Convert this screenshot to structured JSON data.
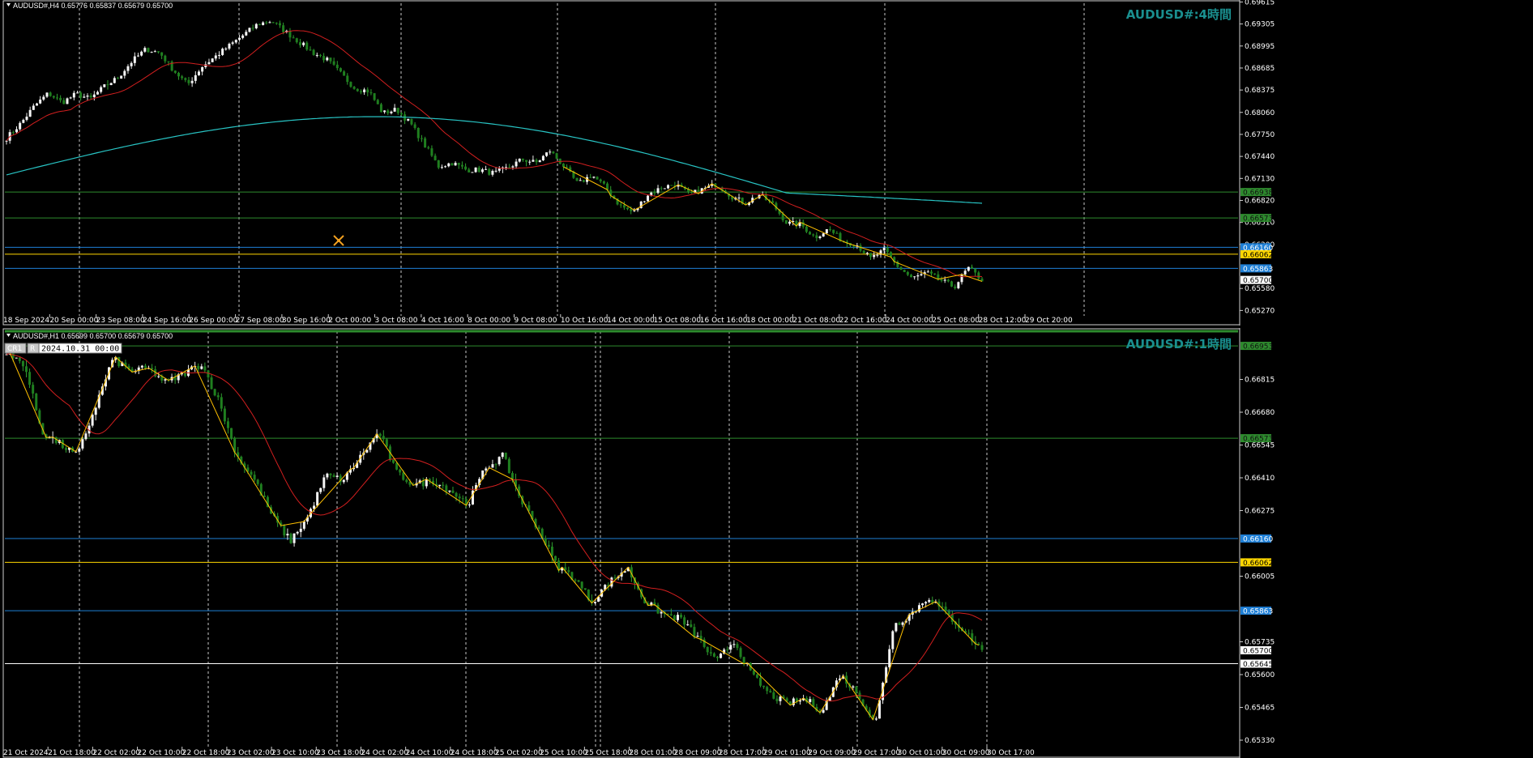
{
  "panels": [
    {
      "title": "AUDUSD#,H4  0.65776 0.65837 0.65679 0.65700",
      "watermark": "AUDUSD#:4時間",
      "timeframe": "H4",
      "y_ticks": [
        "0.69615",
        "0.69305",
        "0.68995",
        "0.68685",
        "0.68375",
        "0.68060",
        "0.67750",
        "0.67440",
        "0.67130",
        "0.66820",
        "0.66510",
        "0.66200",
        "0.65580",
        "0.65270"
      ],
      "x_ticks": [
        "18 Sep 2024",
        "20 Sep 00:00",
        "23 Sep 08:00",
        "24 Sep 16:00",
        "26 Sep 00:00",
        "27 Sep 08:00",
        "30 Sep 16:00",
        "2 Oct 00:00",
        "3 Oct 08:00",
        "4 Oct 16:00",
        "8 Oct 00:00",
        "9 Oct 08:00",
        "10 Oct 16:00",
        "14 Oct 00:00",
        "15 Oct 08:00",
        "16 Oct 16:00",
        "18 Oct 00:00",
        "21 Oct 08:00",
        "22 Oct 16:00",
        "24 Oct 00:00",
        "25 Oct 08:00",
        "28 Oct 12:00",
        "29 Oct 20:00"
      ],
      "price_tags": [
        {
          "label": "0.66938",
          "color": "#2e8b2e",
          "text": "#111111"
        },
        {
          "label": "0.66573",
          "color": "#2e8b2e",
          "text": "#111111"
        },
        {
          "label": "0.66160",
          "color": "#1e7fd6",
          "text": "#ffffff"
        },
        {
          "label": "0.66062",
          "color": "#ffd700",
          "text": "#000000"
        },
        {
          "label": "0.65863",
          "color": "#1e7fd6",
          "text": "#ffffff"
        },
        {
          "label": "0.65700",
          "color": "#ffffff",
          "text": "#000000"
        }
      ]
    },
    {
      "title": "AUDUSD#,H1  0.65699 0.65700 0.65679 0.65700",
      "watermark": "AUDUSD#:1時間",
      "timeframe": "H1",
      "datetime_badge": "2024.10.31 00:00",
      "tool_buttons": [
        "CR1",
        "R"
      ],
      "y_ticks": [
        "0.66815",
        "0.66680",
        "0.66545",
        "0.66410",
        "0.66275",
        "0.66005",
        "0.65735",
        "0.65600",
        "0.65465",
        "0.65330"
      ],
      "x_ticks": [
        "21 Oct 2024",
        "21 Oct 18:00",
        "22 Oct 02:00",
        "22 Oct 10:00",
        "22 Oct 18:00",
        "23 Oct 02:00",
        "23 Oct 10:00",
        "23 Oct 18:00",
        "24 Oct 02:00",
        "24 Oct 10:00",
        "24 Oct 18:00",
        "25 Oct 02:00",
        "25 Oct 10:00",
        "25 Oct 18:00",
        "28 Oct 01:00",
        "28 Oct 09:00",
        "28 Oct 17:00",
        "29 Oct 01:00",
        "29 Oct 09:00",
        "29 Oct 17:00",
        "30 Oct 01:00",
        "30 Oct 09:00",
        "30 Oct 17:00"
      ],
      "price_tags": [
        {
          "label": "0.66953",
          "color": "#2e8b2e",
          "text": "#111111"
        },
        {
          "label": "0.66573",
          "color": "#2e8b2e",
          "text": "#111111"
        },
        {
          "label": "0.66160",
          "color": "#1e7fd6",
          "text": "#ffffff"
        },
        {
          "label": "0.66062",
          "color": "#ffd700",
          "text": "#000000"
        },
        {
          "label": "0.65863",
          "color": "#1e7fd6",
          "text": "#ffffff"
        },
        {
          "label": "0.65700",
          "color": "#ffffff",
          "text": "#000000"
        },
        {
          "label": "0.65645",
          "color": "#ffffff",
          "text": "#000000"
        }
      ]
    }
  ],
  "chart_data": [
    {
      "type": "candlestick",
      "symbol": "AUDUSD#",
      "timeframe": "H4",
      "ylim": [
        0.6524,
        0.6962
      ],
      "x_tick_labels": [
        "18 Sep 2024",
        "20 Sep 00:00",
        "23 Sep 08:00",
        "24 Sep 16:00",
        "26 Sep 00:00",
        "27 Sep 08:00",
        "30 Sep 16:00",
        "2 Oct 00:00",
        "3 Oct 08:00",
        "4 Oct 16:00",
        "8 Oct 00:00",
        "9 Oct 08:00",
        "10 Oct 16:00",
        "14 Oct 00:00",
        "15 Oct 08:00",
        "16 Oct 16:00",
        "18 Oct 00:00",
        "21 Oct 08:00",
        "22 Oct 16:00",
        "24 Oct 00:00",
        "25 Oct 08:00",
        "28 Oct 12:00",
        "29 Oct 20:00"
      ],
      "close_path": [
        0.677,
        0.679,
        0.6815,
        0.6833,
        0.682,
        0.6832,
        0.6825,
        0.6842,
        0.6855,
        0.6878,
        0.6895,
        0.689,
        0.6865,
        0.6845,
        0.687,
        0.6885,
        0.69,
        0.6915,
        0.693,
        0.6935,
        0.692,
        0.6905,
        0.689,
        0.688,
        0.686,
        0.684,
        0.6836,
        0.6805,
        0.681,
        0.679,
        0.676,
        0.673,
        0.6735,
        0.6725,
        0.6725,
        0.672,
        0.6728,
        0.674,
        0.6735,
        0.6752,
        0.673,
        0.6705,
        0.6718,
        0.67,
        0.6675,
        0.6665,
        0.669,
        0.67,
        0.6705,
        0.669,
        0.6698,
        0.6705,
        0.6688,
        0.6678,
        0.669,
        0.6676,
        0.665,
        0.6648,
        0.663,
        0.6642,
        0.6625,
        0.662,
        0.66,
        0.6612,
        0.6588,
        0.6572,
        0.658,
        0.657,
        0.656,
        0.6587,
        0.657
      ],
      "series": [
        {
          "name": "MA fast",
          "color": "#d21f1f"
        },
        {
          "name": "MA slow",
          "color": "#28c4c4"
        },
        {
          "name": "ZigZag",
          "color": "#ffc000"
        }
      ],
      "horizontal_levels": [
        0.66938,
        0.66573,
        0.6616,
        0.66062,
        0.65863
      ],
      "last_price": 0.657
    },
    {
      "type": "candlestick",
      "symbol": "AUDUSD#",
      "timeframe": "H1",
      "ylim": [
        0.6531,
        0.6701
      ],
      "x_tick_labels": [
        "21 Oct 2024",
        "21 Oct 18:00",
        "22 Oct 02:00",
        "22 Oct 10:00",
        "22 Oct 18:00",
        "23 Oct 02:00",
        "23 Oct 10:00",
        "23 Oct 18:00",
        "24 Oct 02:00",
        "24 Oct 10:00",
        "24 Oct 18:00",
        "25 Oct 02:00",
        "25 Oct 10:00",
        "25 Oct 18:00",
        "28 Oct 01:00",
        "28 Oct 09:00",
        "28 Oct 17:00",
        "29 Oct 01:00",
        "29 Oct 09:00",
        "29 Oct 17:00",
        "30 Oct 01:00",
        "30 Oct 09:00",
        "30 Oct 17:00"
      ],
      "close_path": [
        0.6692,
        0.6688,
        0.666,
        0.6655,
        0.665,
        0.667,
        0.669,
        0.6685,
        0.6686,
        0.668,
        0.6684,
        0.6688,
        0.6672,
        0.665,
        0.664,
        0.6625,
        0.6615,
        0.6625,
        0.6642,
        0.664,
        0.665,
        0.666,
        0.6643,
        0.6638,
        0.664,
        0.6636,
        0.663,
        0.6645,
        0.665,
        0.6632,
        0.662,
        0.6605,
        0.66,
        0.659,
        0.6598,
        0.6604,
        0.659,
        0.6585,
        0.6583,
        0.6575,
        0.6565,
        0.6574,
        0.656,
        0.6552,
        0.6548,
        0.655,
        0.6545,
        0.656,
        0.6552,
        0.654,
        0.658,
        0.6585,
        0.6592,
        0.6585,
        0.6578,
        0.657
      ],
      "series": [
        {
          "name": "MA",
          "color": "#d21f1f"
        },
        {
          "name": "ZigZag",
          "color": "#ffc000"
        }
      ],
      "horizontal_levels": [
        0.66953,
        0.66573,
        0.6616,
        0.66062,
        0.65863,
        0.65645
      ],
      "last_price": 0.657
    }
  ]
}
